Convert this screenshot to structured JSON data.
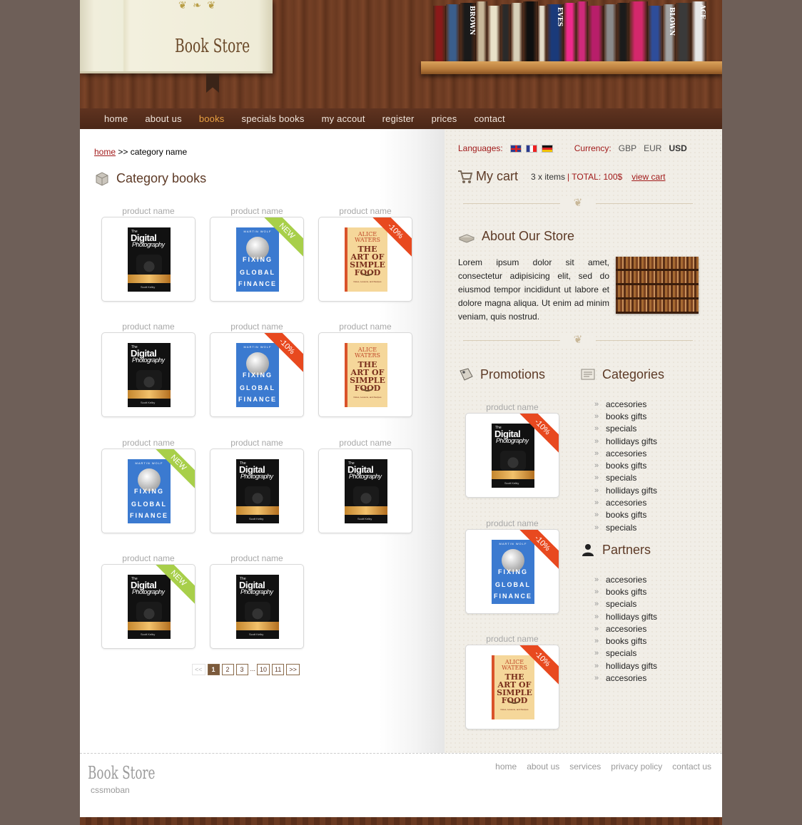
{
  "header": {
    "store_title": "Book Store",
    "shelf_colors": [
      "#8a1a1a",
      "#3a5e8c",
      "#1a1a1a",
      "#c8b89a",
      "#e9e1c8",
      "#2a2a2a",
      "#d8d0b8",
      "#0f0f0f",
      "#e2dac8",
      "#1a3a7a",
      "#f02a8c",
      "#cf2a7a",
      "#b81e6a",
      "#8a8a8a",
      "#1b1b1b",
      "#d4286c",
      "#2e4d9a",
      "#a2a2a2",
      "#3a3a3a",
      "#e6e6e6"
    ],
    "shelf_titles": [
      "",
      "",
      "BROWN",
      "",
      "",
      "",
      "",
      "",
      "",
      "EVES",
      "",
      "",
      "",
      "",
      "",
      "",
      "",
      "BLOWN",
      "",
      "ACE"
    ]
  },
  "nav": {
    "items": [
      "home",
      "about us",
      "books",
      "specials books",
      "my accout",
      "register",
      "prices",
      "contact"
    ],
    "active": "books"
  },
  "breadcrumb": {
    "home": "home",
    "sep": ">>",
    "current": "category name"
  },
  "category": {
    "title": "Category books",
    "products": [
      {
        "name": "product name",
        "cover": "digital",
        "badge": ""
      },
      {
        "name": "product name",
        "cover": "fixing",
        "badge": "NEW"
      },
      {
        "name": "product name",
        "cover": "alice",
        "badge": "-10%"
      },
      {
        "name": "product name",
        "cover": "digital",
        "badge": ""
      },
      {
        "name": "product name",
        "cover": "fixing",
        "badge": "-10%"
      },
      {
        "name": "product name",
        "cover": "alice",
        "badge": ""
      },
      {
        "name": "product name",
        "cover": "fixing",
        "badge": "NEW"
      },
      {
        "name": "product name",
        "cover": "digital",
        "badge": ""
      },
      {
        "name": "product name",
        "cover": "digital",
        "badge": ""
      },
      {
        "name": "product name",
        "cover": "digital",
        "badge": "NEW"
      },
      {
        "name": "product name",
        "cover": "digital",
        "badge": ""
      }
    ]
  },
  "covers": {
    "digital": {
      "small": "The",
      "title": "Digital",
      "subtitle": "Photography",
      "author": "Scott Kelby"
    },
    "fixing": {
      "author": "MARTIN WOLF",
      "w1": "FIXING",
      "w2": "GLOBAL",
      "w3": "FINANCE"
    },
    "alice": {
      "author": "ALICE WATERS",
      "title": "THE ART OF SIMPLE FOOD",
      "sub": "Notes, Lessons, and Recipes"
    }
  },
  "pager": {
    "prev": "<<",
    "pages": [
      "1",
      "2",
      "3"
    ],
    "dots": "...",
    "last_pages": [
      "10",
      "11"
    ],
    "next": ">>"
  },
  "sidebar": {
    "languages_label": "Languages:",
    "currency_label": "Currency:",
    "currencies": [
      "GBP",
      "EUR",
      "USD"
    ],
    "cart_title": "My cart",
    "cart_items": "3 x items",
    "cart_total": "| TOTAL: 100$",
    "view_cart": "view cart",
    "about_title": "About Our Store",
    "about_text": "Lorem ipsum dolor sit amet, consectetur adipisicing elit, sed do eiusmod tempor incididunt ut labore et dolore magna aliqua. Ut enim ad minim veniam, quis nostrud.",
    "promotions_title": "Promotions",
    "promotions": [
      {
        "name": "product name",
        "cover": "digital",
        "badge": "-10%"
      },
      {
        "name": "product name",
        "cover": "fixing",
        "badge": "-10%"
      },
      {
        "name": "product name",
        "cover": "alice",
        "badge": "-10%"
      }
    ],
    "categories_title": "Categories",
    "categories": [
      "accesories",
      "books gifts",
      "specials",
      "hollidays gifts",
      "accesories",
      "books gifts",
      "specials",
      "hollidays gifts",
      "accesories",
      "books gifts",
      "specials"
    ],
    "partners_title": "Partners",
    "partners": [
      "accesories",
      "books gifts",
      "specials",
      "hollidays gifts",
      "accesories",
      "books gifts",
      "specials",
      "hollidays gifts",
      "accesories"
    ]
  },
  "footer": {
    "logo": "Book Store",
    "sub": "cssmoban",
    "links": [
      "home",
      "about us",
      "services",
      "privacy policy",
      "contact us"
    ]
  }
}
